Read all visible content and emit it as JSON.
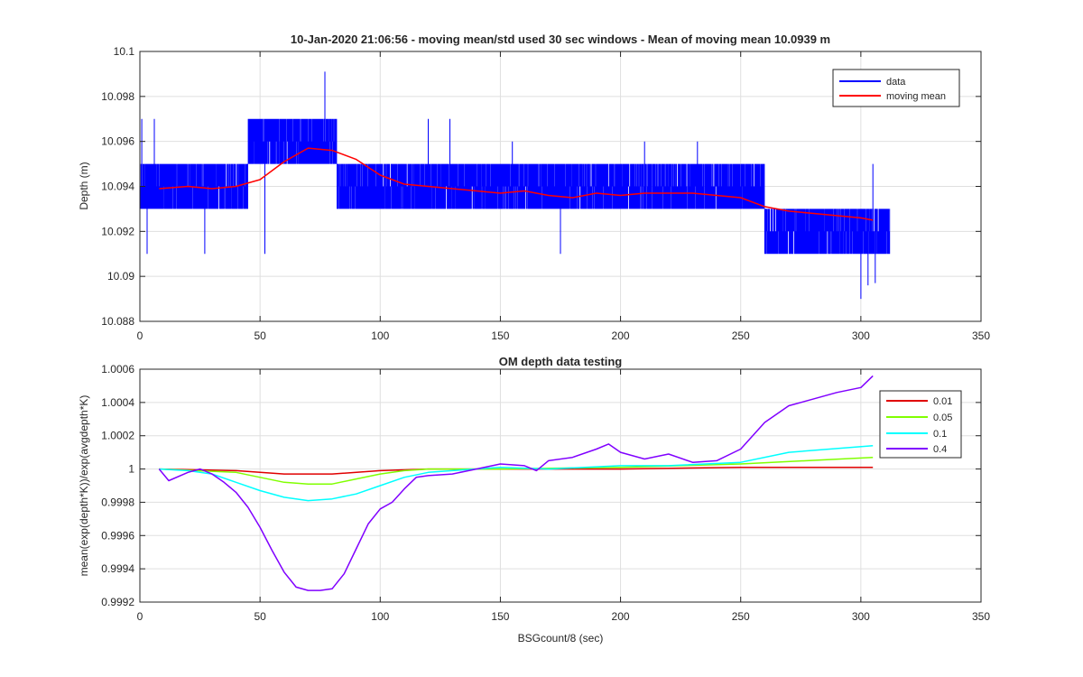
{
  "chart_data": [
    {
      "type": "line",
      "title": "10-Jan-2020 21:06:56 - moving mean/std used 30 sec windows - Mean of moving mean 10.0939 m",
      "xlabel": "",
      "ylabel": "Depth (m)",
      "xlim": [
        0,
        350
      ],
      "ylim": [
        10.088,
        10.1
      ],
      "xticks": [
        0,
        50,
        100,
        150,
        200,
        250,
        300,
        350
      ],
      "yticks": [
        10.088,
        10.09,
        10.092,
        10.094,
        10.096,
        10.098,
        10.1
      ],
      "ytick_labels": [
        "10.088",
        "10.09",
        "10.092",
        "10.094",
        "10.096",
        "10.098",
        "10.1"
      ],
      "grid": true,
      "legend_position": "top-right",
      "colors": {
        "data": "#0000ff",
        "moving mean": "#ff0000"
      },
      "series": [
        {
          "name": "data",
          "x": [
            0,
            45,
            45,
            82,
            82,
            130,
            130,
            180,
            180,
            260,
            260,
            312
          ],
          "y_min": [
            10.093,
            10.093,
            10.095,
            10.095,
            10.093,
            10.093,
            10.093,
            10.093,
            10.093,
            10.093,
            10.091,
            10.091
          ],
          "y_max": [
            10.095,
            10.095,
            10.097,
            10.097,
            10.095,
            10.095,
            10.095,
            10.095,
            10.095,
            10.095,
            10.093,
            10.093
          ],
          "spikes_high": [
            [
              0.8,
              10.097
            ],
            [
              6,
              10.097
            ],
            [
              48,
              10.096
            ],
            [
              77,
              10.0991
            ],
            [
              120,
              10.097
            ],
            [
              129,
              10.097
            ],
            [
              155,
              10.096
            ],
            [
              210,
              10.096
            ],
            [
              232,
              10.096
            ],
            [
              305,
              10.095
            ]
          ],
          "spikes_low": [
            [
              3,
              10.091
            ],
            [
              27,
              10.091
            ],
            [
              52,
              10.091
            ],
            [
              175,
              10.091
            ],
            [
              300,
              10.089
            ],
            [
              303,
              10.0896
            ],
            [
              306,
              10.0897
            ],
            [
              310,
              10.091
            ]
          ]
        },
        {
          "name": "moving mean",
          "x": [
            8,
            20,
            30,
            40,
            50,
            60,
            70,
            80,
            90,
            100,
            110,
            120,
            130,
            140,
            150,
            160,
            170,
            180,
            190,
            200,
            210,
            220,
            230,
            240,
            250,
            260,
            270,
            280,
            290,
            300,
            305
          ],
          "y": [
            10.0939,
            10.094,
            10.0939,
            10.094,
            10.0943,
            10.0951,
            10.0957,
            10.0956,
            10.0952,
            10.0945,
            10.0941,
            10.094,
            10.0939,
            10.0938,
            10.0937,
            10.0938,
            10.0936,
            10.0935,
            10.0937,
            10.0936,
            10.0937,
            10.0937,
            10.0937,
            10.0936,
            10.0935,
            10.0931,
            10.0929,
            10.0928,
            10.0927,
            10.0926,
            10.0925
          ]
        }
      ]
    },
    {
      "type": "line",
      "title": "OM depth data testing",
      "xlabel": "BSGcount/8 (sec)",
      "ylabel": "mean(exp(depth*K))/exp(avgdepth*K)",
      "xlim": [
        0,
        350
      ],
      "ylim": [
        0.9992,
        1.0006
      ],
      "xticks": [
        0,
        50,
        100,
        150,
        200,
        250,
        300,
        350
      ],
      "yticks": [
        0.9992,
        0.9994,
        0.9996,
        0.9998,
        1,
        1.0002,
        1.0004,
        1.0006
      ],
      "ytick_labels": [
        "0.9992",
        "0.9994",
        "0.9996",
        "0.9998",
        "1",
        "1.0002",
        "1.0004",
        "1.0006"
      ],
      "grid": true,
      "legend_position": "top-right",
      "colors": {
        "0.01": "#e00000",
        "0.05": "#80ff00",
        "0.1": "#00ffff",
        "0.4": "#8000ff"
      },
      "series": [
        {
          "name": "0.01",
          "x": [
            8,
            40,
            60,
            80,
            100,
            120,
            150,
            200,
            250,
            305
          ],
          "y": [
            1.0,
            0.99999,
            0.99997,
            0.99997,
            0.99999,
            1.0,
            1.0,
            1.0,
            1.00001,
            1.00001
          ]
        },
        {
          "name": "0.05",
          "x": [
            8,
            40,
            60,
            70,
            80,
            90,
            100,
            110,
            120,
            150,
            200,
            250,
            305
          ],
          "y": [
            1.0,
            0.99998,
            0.99992,
            0.99991,
            0.99991,
            0.99994,
            0.99997,
            0.99999,
            1.0,
            1.0,
            1.00001,
            1.00003,
            1.00007
          ]
        },
        {
          "name": "0.1",
          "x": [
            8,
            20,
            30,
            40,
            50,
            60,
            70,
            80,
            90,
            100,
            110,
            120,
            130,
            150,
            170,
            200,
            220,
            250,
            270,
            305
          ],
          "y": [
            1.0,
            0.99999,
            0.99997,
            0.99992,
            0.99987,
            0.99983,
            0.99981,
            0.99982,
            0.99985,
            0.9999,
            0.99995,
            0.99998,
            0.99999,
            1.00001,
            1.0,
            1.00002,
            1.00002,
            1.00004,
            1.0001,
            1.00014
          ]
        },
        {
          "name": "0.4",
          "x": [
            8,
            12,
            20,
            25,
            30,
            35,
            40,
            45,
            50,
            55,
            60,
            65,
            70,
            75,
            80,
            85,
            90,
            95,
            100,
            105,
            110,
            115,
            120,
            130,
            140,
            150,
            160,
            165,
            170,
            180,
            190,
            195,
            200,
            210,
            220,
            230,
            240,
            250,
            260,
            270,
            280,
            290,
            300,
            305
          ],
          "y": [
            1.0,
            0.99993,
            0.99998,
            1.0,
            0.99997,
            0.99992,
            0.99986,
            0.99977,
            0.99965,
            0.99951,
            0.99938,
            0.99929,
            0.99927,
            0.99927,
            0.99928,
            0.99937,
            0.99952,
            0.99967,
            0.99976,
            0.9998,
            0.99988,
            0.99995,
            0.99996,
            0.99997,
            1.0,
            1.00003,
            1.00002,
            0.99999,
            1.00005,
            1.00007,
            1.00012,
            1.00015,
            1.0001,
            1.00006,
            1.00009,
            1.00004,
            1.00005,
            1.00012,
            1.00028,
            1.00038,
            1.00042,
            1.00046,
            1.00049,
            1.00056
          ]
        }
      ]
    }
  ]
}
